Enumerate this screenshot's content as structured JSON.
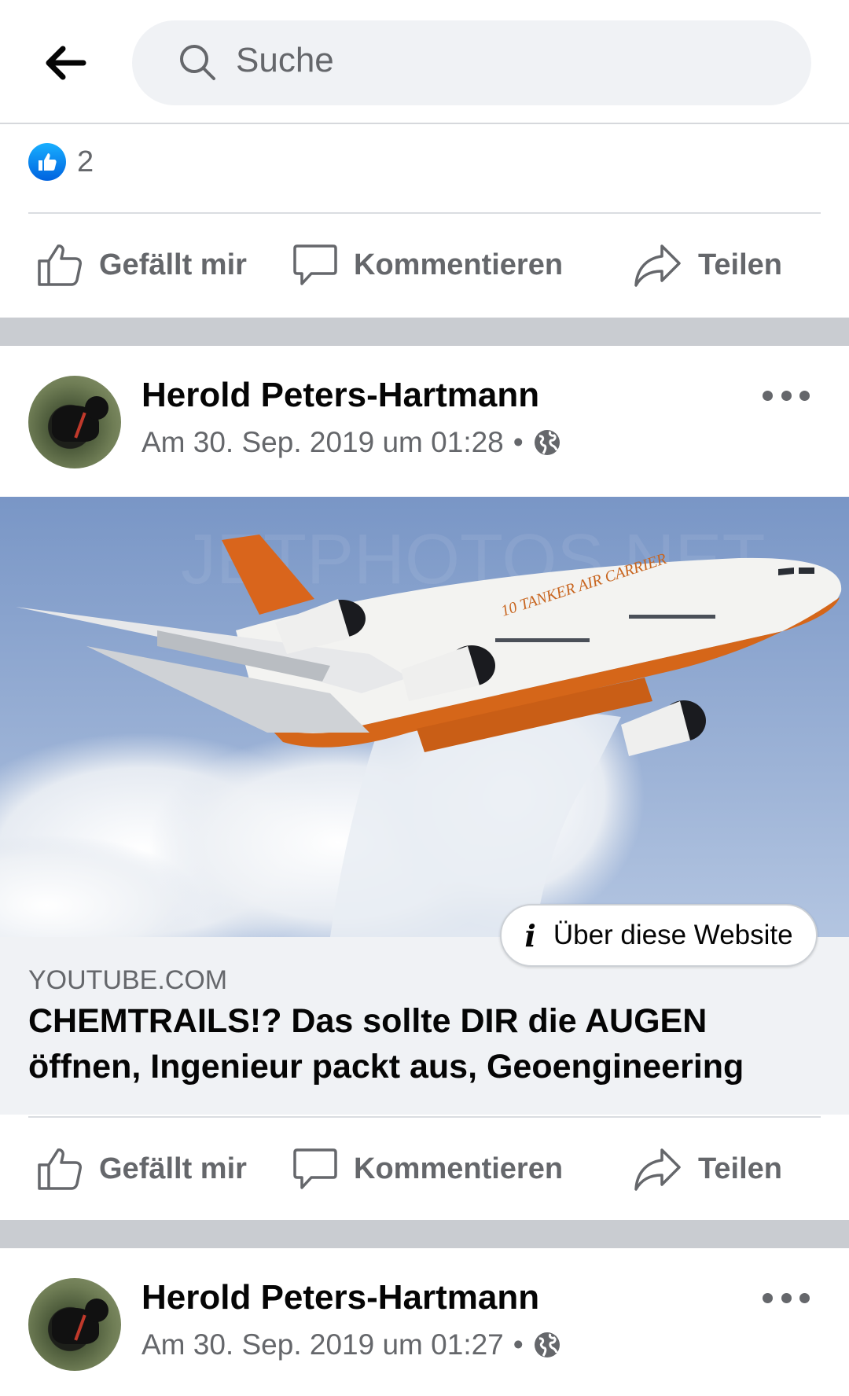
{
  "search": {
    "placeholder": "Suche"
  },
  "previous_post": {
    "reaction_count": "2"
  },
  "actions": {
    "like": "Gefällt mir",
    "comment": "Kommentieren",
    "share": "Teilen"
  },
  "posts": [
    {
      "author": "Herold Peters-Hartmann",
      "timestamp": "Am 30. Sep. 2019 um 01:28",
      "privacy_icon": "globe-icon",
      "link": {
        "image_watermark": "JETPHOTOS.NET",
        "plane_livery": "10 TANKER AIR CARRIER",
        "about_label": "Über diese Website",
        "domain": "YOUTUBE.COM",
        "title": "CHEMTRAILS!? Das sollte DIR die AUGEN öffnen, Ingenieur packt aus, Geoengineering"
      }
    },
    {
      "author": "Herold Peters-Hartmann",
      "timestamp": "Am 30. Sep. 2019 um 01:27",
      "privacy_icon": "globe-icon"
    }
  ],
  "colors": {
    "like_blue": "#1877f2",
    "secondary_text": "#65676b",
    "separator": "#c9ccd1"
  }
}
